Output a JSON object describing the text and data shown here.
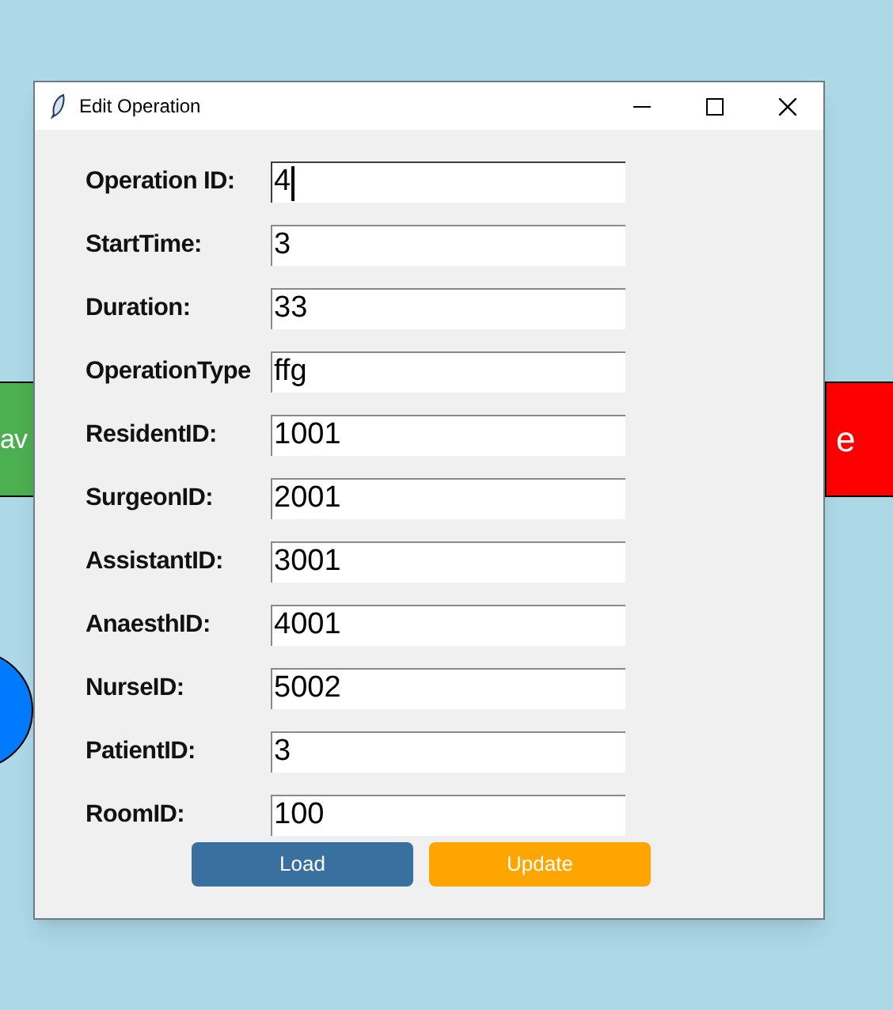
{
  "background": {
    "left_button": {
      "label": "av"
    },
    "right_button": {
      "label": "e"
    }
  },
  "window": {
    "title": "Edit Operation"
  },
  "fields": [
    {
      "label": "Operation ID:",
      "value": "4",
      "focused": true
    },
    {
      "label": "StartTime:",
      "value": "3",
      "focused": false
    },
    {
      "label": "Duration:",
      "value": "33",
      "focused": false
    },
    {
      "label": "OperationType",
      "value": "ffg",
      "focused": false
    },
    {
      "label": "ResidentID:",
      "value": "1001",
      "focused": false
    },
    {
      "label": "SurgeonID:",
      "value": "2001",
      "focused": false
    },
    {
      "label": "AssistantID:",
      "value": "3001",
      "focused": false
    },
    {
      "label": "AnaesthID:",
      "value": "4001",
      "focused": false
    },
    {
      "label": "NurseID:",
      "value": "5002",
      "focused": false
    },
    {
      "label": "PatientID:",
      "value": "3",
      "focused": false
    },
    {
      "label": "RoomID:",
      "value": "100",
      "focused": false
    }
  ],
  "buttons": [
    {
      "label": "Load",
      "kind": "load"
    },
    {
      "label": "Update",
      "kind": "update"
    }
  ]
}
